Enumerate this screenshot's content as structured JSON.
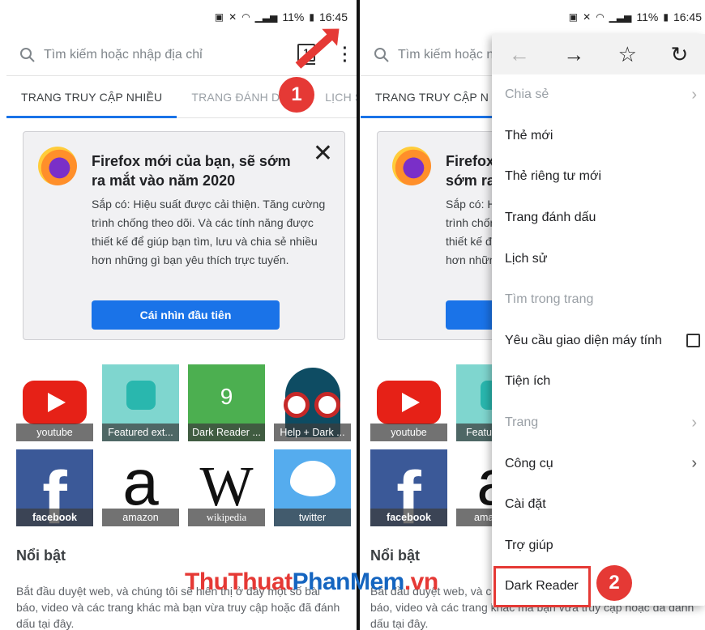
{
  "status_bar": {
    "text": "11%",
    "time": "16:45"
  },
  "search": {
    "placeholder": "Tìm kiếm hoặc nhập địa chỉ",
    "placeholder_short": "Tìm kiếm hoặc n",
    "tab_count": "1"
  },
  "tabs": [
    {
      "label": "TRANG TRUY CẬP NHIỀU"
    },
    {
      "label": "TRANG ĐÁNH DẤU"
    },
    {
      "label": "LỊCH SỬ"
    }
  ],
  "tabs_right": {
    "active_short": "TRANG TRUY CẬP N"
  },
  "promo": {
    "title": "Firefox mới của bạn, sẽ sớm ra mắt vào năm 2020",
    "title_short_1": "Firefox",
    "title_short_2": "sớm ra",
    "body": "Sắp có: Hiệu suất được cải thiện. Tăng cường trình chống theo dõi. Và các tính năng được thiết kế để giúp bạn tìm, lưu và chia sẻ nhiều hơn những gì bạn yêu thích trực tuyến.",
    "cta": "Cái nhìn đầu tiên"
  },
  "top_sites": [
    {
      "label": "youtube"
    },
    {
      "label": "Featured ext..."
    },
    {
      "label": "Dark Reader ...",
      "badge_num": "9"
    },
    {
      "label": "Help + Dark ..."
    },
    {
      "label": "facebook"
    },
    {
      "label": "amazon"
    },
    {
      "label": "wikipedia"
    },
    {
      "label": "twitter"
    }
  ],
  "top_sites_right": {
    "featured": "Featur",
    "amazon": "ama"
  },
  "highlights": {
    "title": "Nổi bật",
    "text": "Bắt đầu duyệt web, và chúng tôi sẽ hiển thị ở đây một số bài báo, video và các trang khác mà bạn vừa truy cập hoặc đã đánh dấu tại đây."
  },
  "menu": {
    "toolbar": {
      "back_icon": "arrow-left-icon",
      "forward_icon": "arrow-right-icon",
      "star_icon": "star-icon",
      "reload_icon": "reload-icon"
    },
    "items": [
      {
        "label": "Chia sẻ",
        "disabled": true,
        "submenu": true
      },
      {
        "label": "Thẻ mới"
      },
      {
        "label": "Thẻ riêng tư mới"
      },
      {
        "label": "Trang đánh dấu"
      },
      {
        "label": "Lịch sử"
      },
      {
        "label": "Tìm trong trang",
        "disabled": true
      },
      {
        "label": "Yêu cầu giao diện máy tính",
        "checkbox": true,
        "checked": false
      },
      {
        "label": "Tiện ích"
      },
      {
        "label": "Trang",
        "disabled": true,
        "submenu": true
      },
      {
        "label": "Công cụ",
        "submenu": true
      },
      {
        "label": "Cài đặt"
      },
      {
        "label": "Trợ giúp"
      },
      {
        "label": "Dark Reader",
        "highlighted": true
      }
    ]
  },
  "annotations": {
    "step1": "1",
    "step2": "2"
  },
  "watermark": {
    "part1": "ThuThuat",
    "part2": "PhanMem",
    "part3": ".vn"
  },
  "colors": {
    "accent": "#1a73e8",
    "annotation": "#e53935"
  }
}
